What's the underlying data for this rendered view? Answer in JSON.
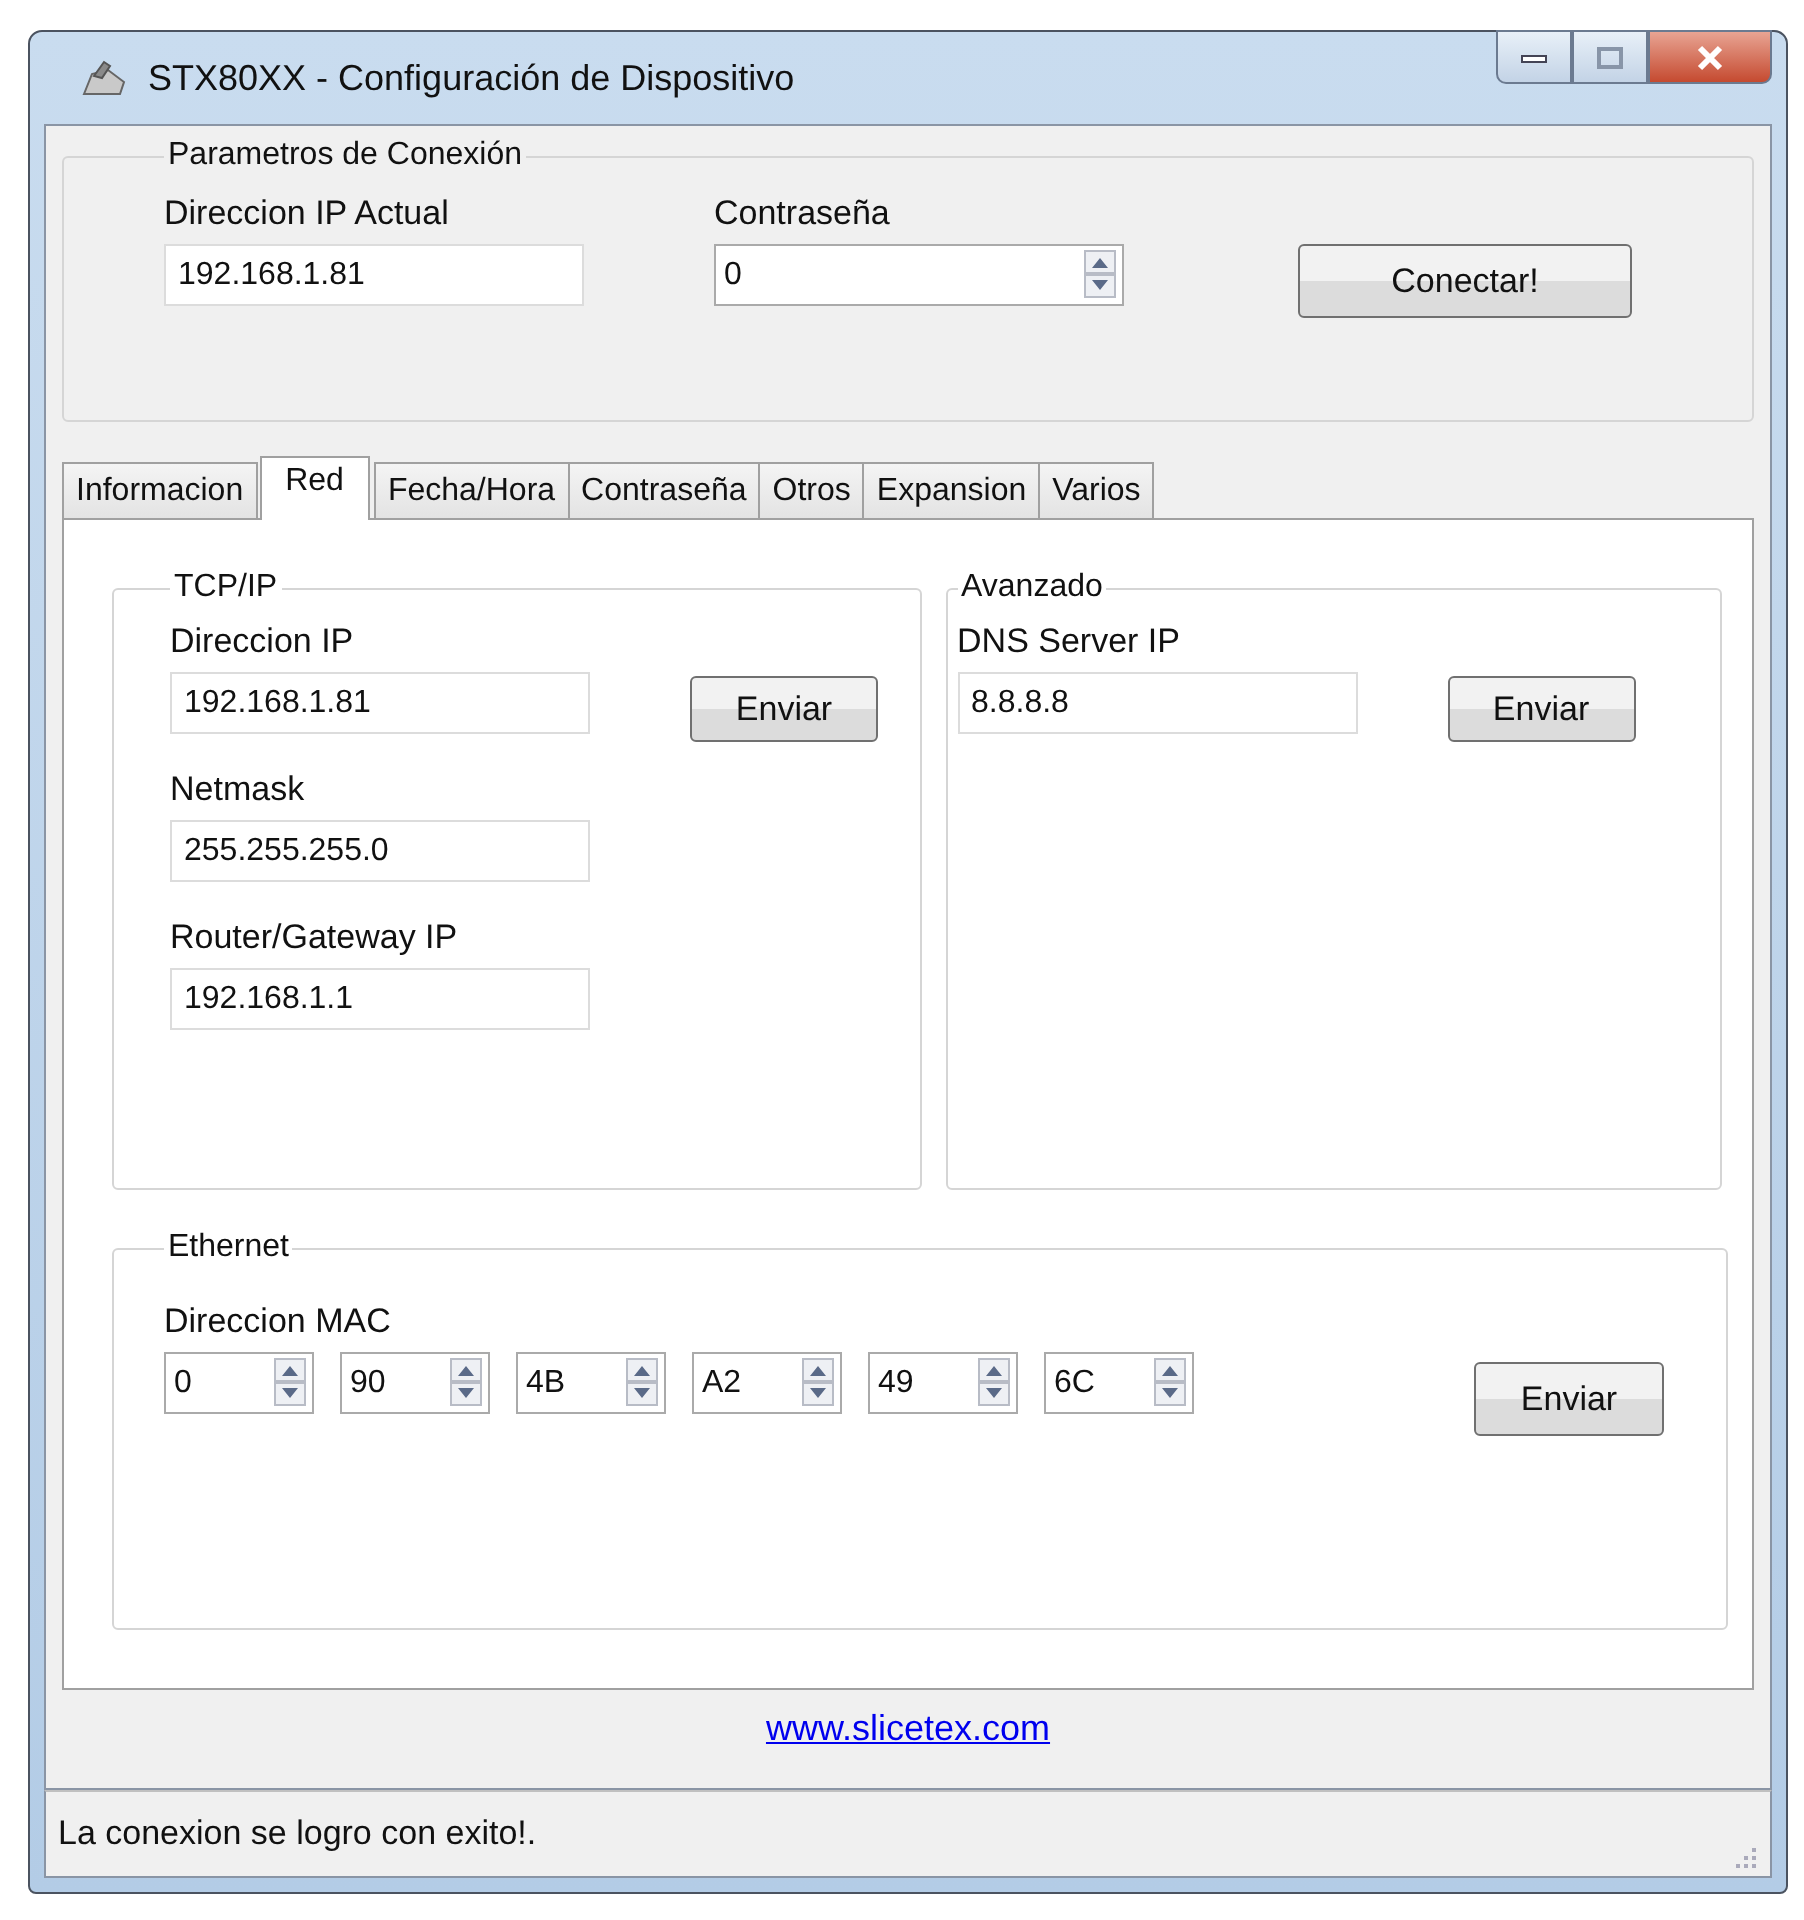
{
  "window": {
    "title": "STX80XX - Configuración de Dispositivo"
  },
  "connection": {
    "legend": "Parametros de Conexión",
    "ip_label": "Direccion IP Actual",
    "ip_value": "192.168.1.81",
    "password_label": "Contraseña",
    "password_value": "0",
    "button": "Conectar!"
  },
  "tabs": [
    {
      "label": "Informacion",
      "selected": false
    },
    {
      "label": "Red",
      "selected": true
    },
    {
      "label": "Fecha/Hora",
      "selected": false
    },
    {
      "label": "Contraseña",
      "selected": false
    },
    {
      "label": "Otros",
      "selected": false
    },
    {
      "label": "Expansion",
      "selected": false
    },
    {
      "label": "Varios",
      "selected": false
    }
  ],
  "tcpip": {
    "legend": "TCP/IP",
    "fields": [
      {
        "label": "Direccion IP",
        "value": "192.168.1.81"
      },
      {
        "label": "Netmask",
        "value": "255.255.255.0"
      },
      {
        "label": "Router/Gateway IP",
        "value": "192.168.1.1"
      }
    ],
    "button": "Enviar"
  },
  "advanced": {
    "legend": "Avanzado",
    "label": "DNS Server IP",
    "value": "8.8.8.8",
    "button": "Enviar"
  },
  "ethernet": {
    "legend": "Ethernet",
    "label": "Direccion MAC",
    "octets": [
      "0",
      "90",
      "4B",
      "A2",
      "49",
      "6C"
    ],
    "button": "Enviar"
  },
  "link": "www.slicetex.com",
  "status_bar": "La conexion se logro con exito!."
}
